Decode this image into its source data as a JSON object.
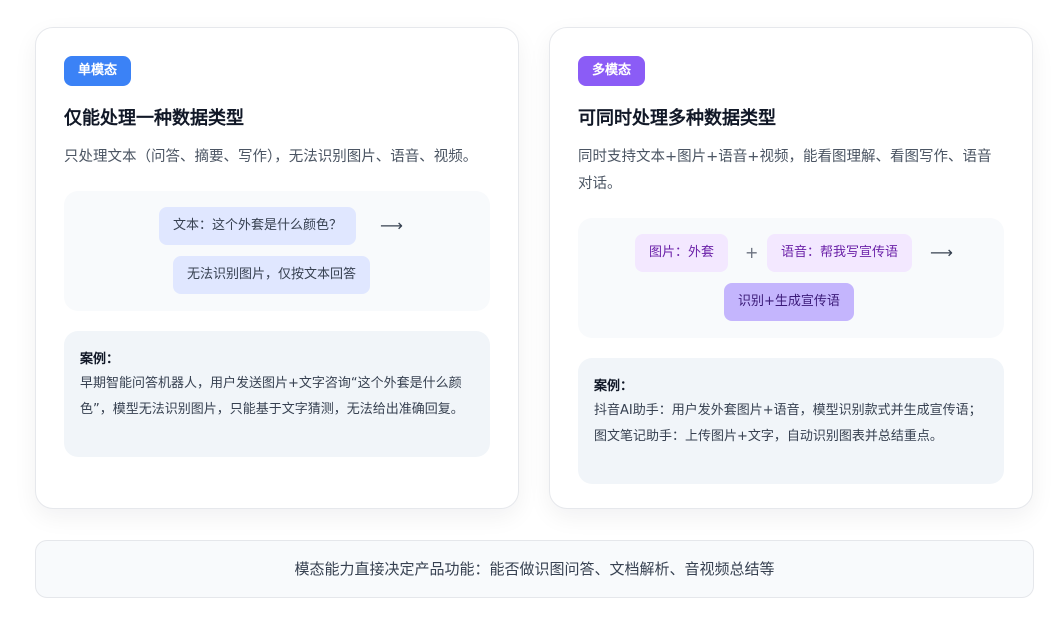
{
  "single": {
    "badge": "单模态",
    "title": "仅能处理一种数据类型",
    "desc": "只处理文本（问答、摘要、写作），无法识别图片、语音、视频。",
    "flow": {
      "input": "文本：这个外套是什么颜色？",
      "arrow": "⟶",
      "output": "无法识别图片，仅按文本回答"
    },
    "case": {
      "title": "案例：",
      "text": "早期智能问答机器人，用户发送图片+文字咨询“这个外套是什么颜色”，模型无法识别图片，只能基于文字猜测，无法给出准确回复。"
    }
  },
  "multi": {
    "badge": "多模态",
    "title": "可同时处理多种数据类型",
    "desc": "同时支持文本+图片+语音+视频，能看图理解、看图写作、语音对话。",
    "flow": {
      "input1": "图片：外套",
      "plus": "+",
      "input2": "语音：帮我写宣传语",
      "arrow": "⟶",
      "output": "识别+生成宣传语"
    },
    "case": {
      "title": "案例：",
      "line1": "抖音AI助手：用户发外套图片+语音，模型识别款式并生成宣传语；",
      "line2": "图文笔记助手：上传图片+文字，自动识别图表并总结重点。"
    }
  },
  "footer": {
    "text": "模态能力直接决定产品功能：能否做识图问答、文档解析、音视频总结等"
  },
  "colors": {
    "single_badge": "#3b82f6",
    "multi_badge": "#8b5cf6"
  }
}
